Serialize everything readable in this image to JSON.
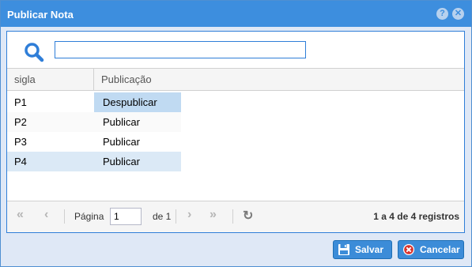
{
  "window": {
    "title": "Publicar Nota",
    "help_glyph": "?",
    "close_glyph": "✕"
  },
  "search": {
    "value": "",
    "placeholder": ""
  },
  "grid": {
    "columns": [
      "sigla",
      "Publicação"
    ],
    "rows": [
      {
        "sigla": "P1",
        "acao": "Despublicar"
      },
      {
        "sigla": "P2",
        "acao": "Publicar"
      },
      {
        "sigla": "P3",
        "acao": "Publicar"
      },
      {
        "sigla": "P4",
        "acao": "Publicar"
      }
    ]
  },
  "pager": {
    "page_label": "Página",
    "page_value": "1",
    "of_label": "de 1",
    "count_text": "1 a 4 de 4 registros",
    "first_glyph": "«",
    "prev_glyph": "‹",
    "next_glyph": "›",
    "last_glyph": "»",
    "refresh_glyph": "↻"
  },
  "footer": {
    "save_label": "Salvar",
    "cancel_label": "Cancelar"
  },
  "colors": {
    "titlebar": "#3d8ede",
    "accent": "#2f7ed8",
    "selected_row": "#dbe9f6",
    "selected_cell": "#c0daf2",
    "cancel_icon": "#d9312b"
  }
}
